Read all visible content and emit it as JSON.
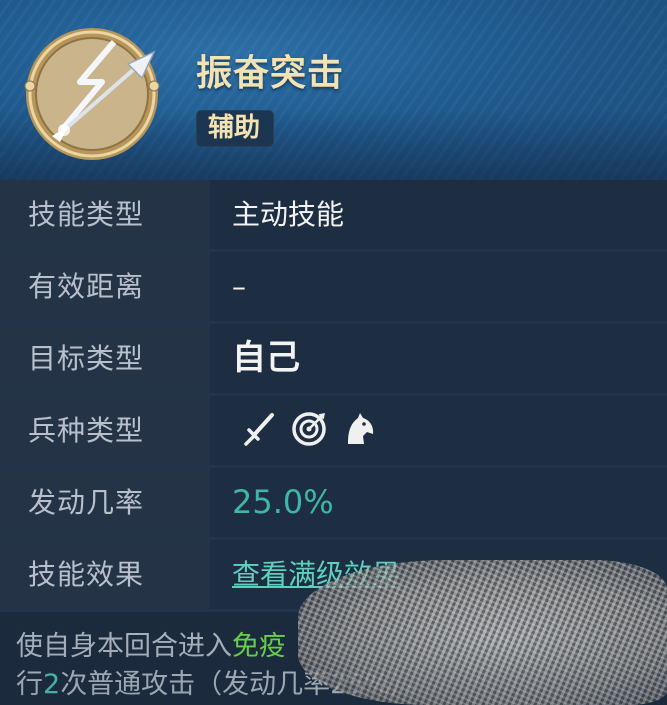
{
  "skill": {
    "name": "振奋突击",
    "badge": "辅助",
    "icon": "spear-icon"
  },
  "rows": [
    {
      "label": "技能类型",
      "value": "主动技能"
    },
    {
      "label": "有效距离",
      "value": "–"
    },
    {
      "label": "目标类型",
      "value": "自己"
    },
    {
      "label": "兵种类型",
      "icons": [
        "sword-icon",
        "target-icon",
        "cavalry-icon"
      ]
    },
    {
      "label": "发动几率",
      "value": "25.0%"
    },
    {
      "label": "技能效果",
      "value": "查看满级效果"
    }
  ],
  "description": {
    "part1": "使自身本回合进入",
    "highlight": "免疫",
    "part2": "行",
    "count": "2",
    "part3": "次普通攻击（发动几率25%）。"
  },
  "colors": {
    "header_bg": "#1f5a8e",
    "title": "#f3e3b2",
    "rate": "#3fb6a8",
    "highlight_green": "#6cd94a",
    "highlight_cyan": "#48c6b4"
  }
}
